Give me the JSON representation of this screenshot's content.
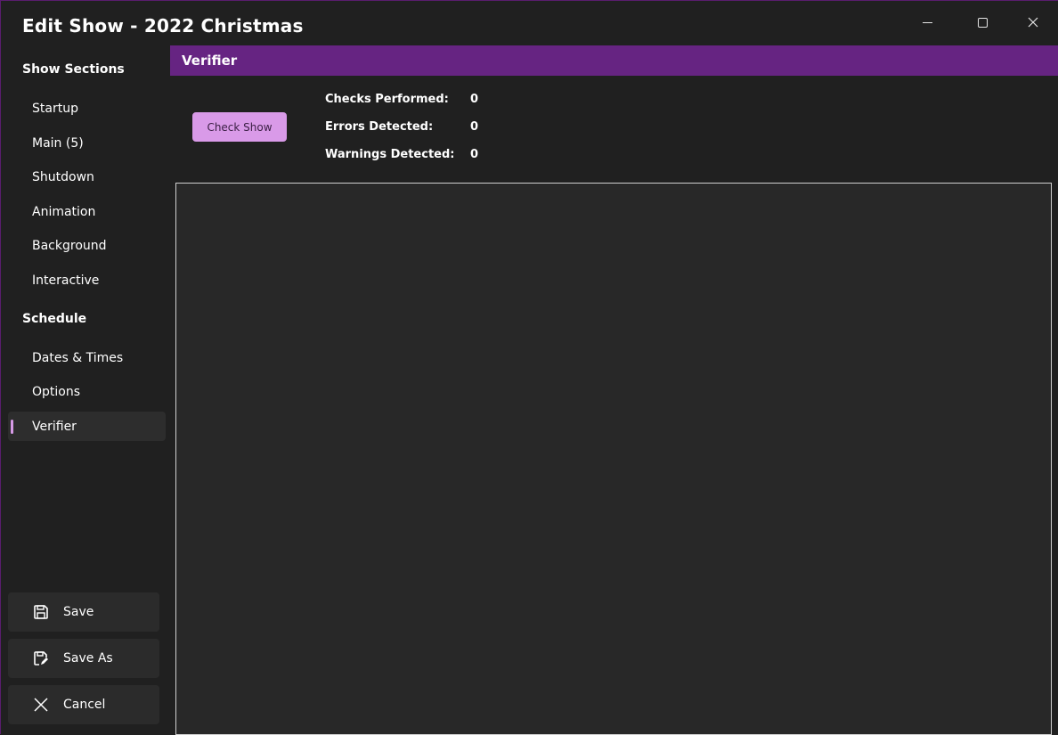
{
  "window": {
    "title": "Edit Show - 2022 Christmas"
  },
  "sidebar": {
    "show_sections_label": "Show Sections",
    "items": [
      {
        "label": "Startup"
      },
      {
        "label": "Main (5)"
      },
      {
        "label": "Shutdown"
      },
      {
        "label": "Animation"
      },
      {
        "label": "Background"
      },
      {
        "label": "Interactive"
      }
    ],
    "schedule_label": "Schedule",
    "schedule_items": [
      {
        "label": "Dates & Times"
      },
      {
        "label": "Options"
      },
      {
        "label": "Verifier",
        "selected": true
      }
    ],
    "actions": {
      "save": "Save",
      "save_as": "Save As",
      "cancel": "Cancel"
    }
  },
  "main": {
    "header_title": "Verifier",
    "check_button": "Check Show",
    "stats": {
      "checks_performed_label": "Checks Performed:",
      "checks_performed_value": "0",
      "errors_detected_label": "Errors Detected:",
      "errors_detected_value": "0",
      "warnings_detected_label": "Warnings Detected:",
      "warnings_detected_value": "0"
    }
  },
  "colors": {
    "accent": "#662482",
    "button": "#d99ae8",
    "selection_indicator": "#d69ae6",
    "background": "#202020"
  },
  "icons": {
    "save": "save-icon",
    "save_as": "save-as-icon",
    "cancel": "close-icon"
  }
}
